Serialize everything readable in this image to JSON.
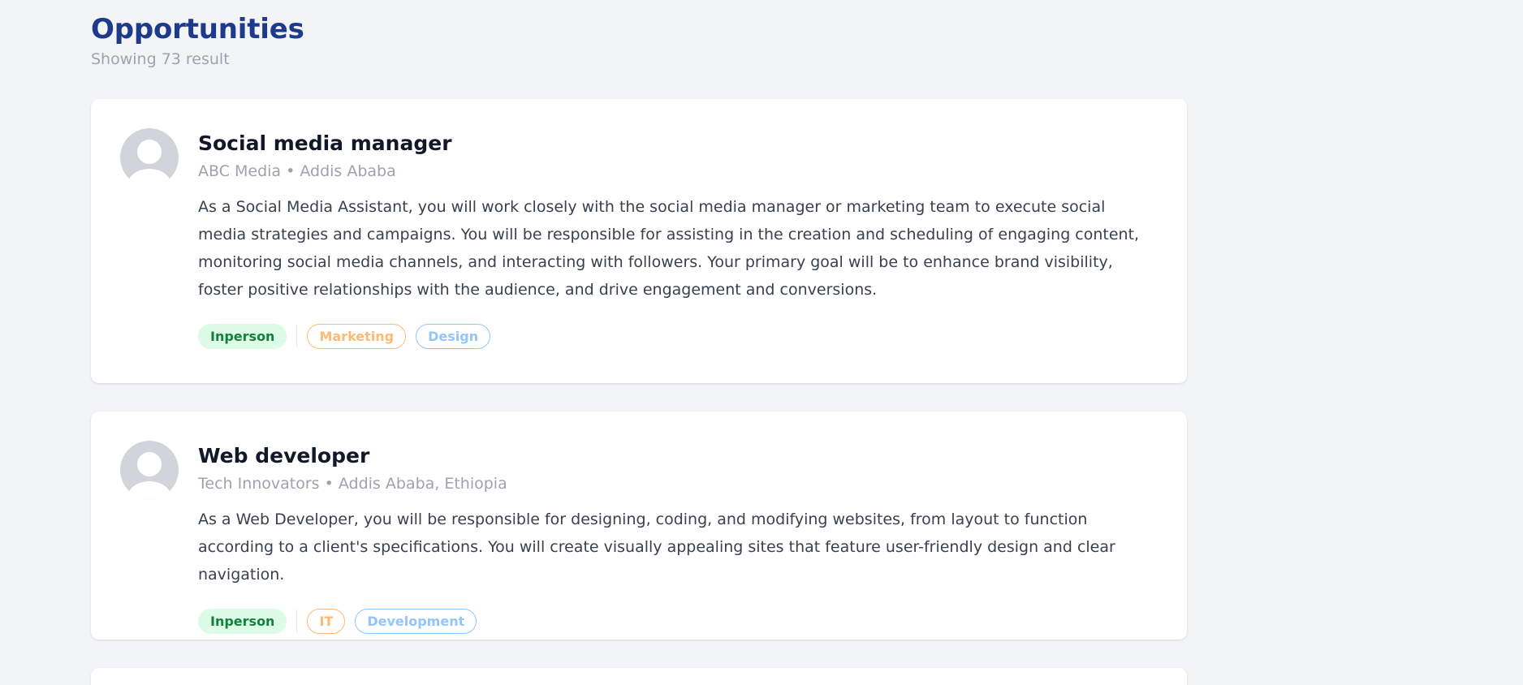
{
  "header": {
    "title": "Opportunities",
    "result_count": "Showing 73 result"
  },
  "jobs": [
    {
      "title": "Social media manager",
      "meta": "ABC Media • Addis Ababa",
      "description": "As a Social Media Assistant, you will work closely with the social media manager or marketing team to execute social media strategies and campaigns. You will be responsible for assisting in the creation and scheduling of engaging content, monitoring social media channels, and interacting with followers. Your primary goal will be to enhance brand visibility, foster positive relationships with the audience, and drive engagement and conversions.",
      "mode": "Inperson",
      "categories": [
        "Marketing",
        "Design"
      ],
      "avatar_icon": "user-icon"
    },
    {
      "title": "Web developer",
      "meta": "Tech Innovators • Addis Ababa, Ethiopia",
      "description": "As a Web Developer, you will be responsible for designing, coding, and modifying websites, from layout to function according to a client's specifications. You will create visually appealing sites that feature user-friendly design and clear navigation.",
      "mode": "Inperson",
      "categories": [
        "IT",
        "Development"
      ],
      "avatar_icon": "user-icon"
    }
  ],
  "colors": {
    "title": "#1e3a8a",
    "mode_tag_bg": "#dcfce7",
    "mode_tag_text": "#15803d",
    "category_orange": "#fdba74",
    "category_blue": "#93c5fd"
  }
}
